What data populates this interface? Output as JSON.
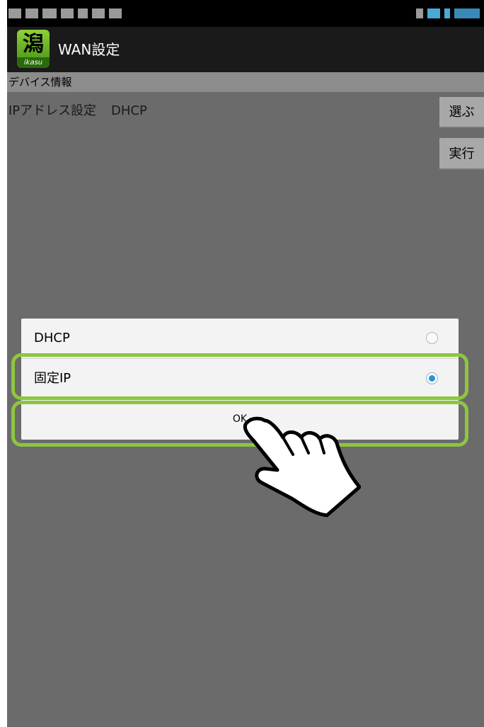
{
  "statusbar": {
    "icons": [
      "notification-icon-1",
      "notification-icon-2",
      "notification-icon-3",
      "notification-icon-4",
      "notification-icon-5",
      "notification-icon-6",
      "notification-icon-7",
      "signal-icon",
      "wifi-icon",
      "battery-icon",
      "clock"
    ]
  },
  "actionbar": {
    "title": "WAN設定",
    "app_icon_text": "ikasu"
  },
  "section": {
    "header": "デバイス情報"
  },
  "setting": {
    "label": "IPアドレス設定",
    "value": "DHCP",
    "select_button": "選ぶ",
    "run_button": "実行"
  },
  "dialog": {
    "options": [
      {
        "label": "DHCP",
        "selected": false
      },
      {
        "label": "固定IP",
        "selected": true
      }
    ],
    "ok_label": "OK"
  },
  "colors": {
    "highlight": "#8dc63f",
    "radio_selected": "#2a95cf",
    "background": "#6b6b6b"
  }
}
